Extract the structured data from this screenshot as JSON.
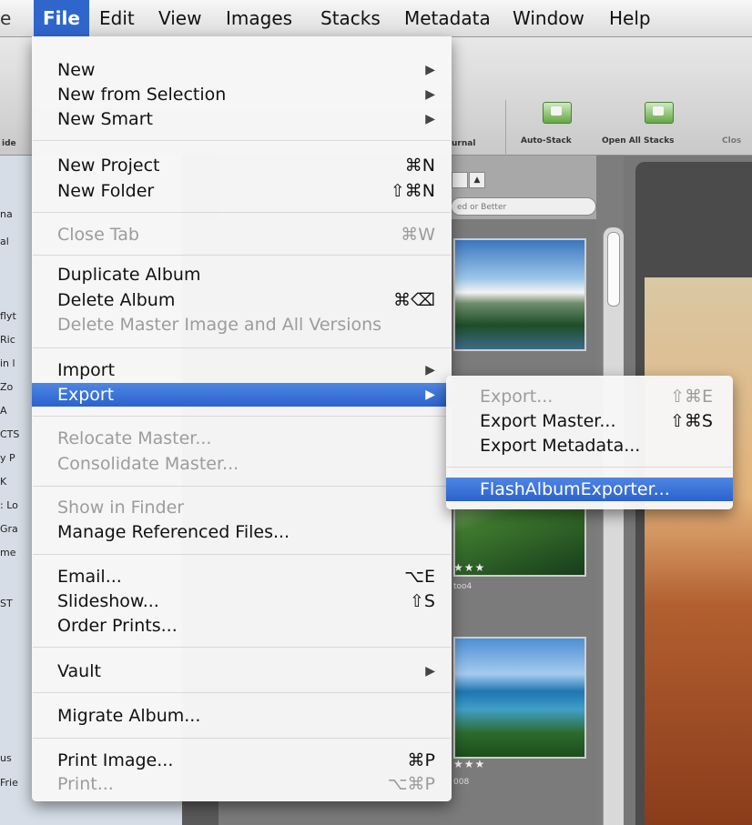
{
  "menubar": {
    "partial_left": "e",
    "items": [
      "File",
      "Edit",
      "View",
      "Images",
      "Stacks",
      "Metadata",
      "Window",
      "Help"
    ]
  },
  "file_menu": {
    "items": [
      {
        "label": "New",
        "shortcut": "",
        "submenu": true,
        "enabled": true
      },
      {
        "label": "New from Selection",
        "shortcut": "",
        "submenu": true,
        "enabled": true
      },
      {
        "label": "New Smart",
        "shortcut": "",
        "submenu": true,
        "enabled": true
      },
      {
        "label": "New Project",
        "shortcut": "⌘N",
        "submenu": false,
        "enabled": true
      },
      {
        "label": "New Folder",
        "shortcut": "⇧⌘N",
        "submenu": false,
        "enabled": true
      },
      {
        "label": "Close Tab",
        "shortcut": "⌘W",
        "submenu": false,
        "enabled": false
      },
      {
        "label": "Duplicate Album",
        "shortcut": "",
        "submenu": false,
        "enabled": true
      },
      {
        "label": "Delete Album",
        "shortcut": "⌘⌫",
        "submenu": false,
        "enabled": true
      },
      {
        "label": "Delete Master Image and All Versions",
        "shortcut": "",
        "submenu": false,
        "enabled": false
      },
      {
        "label": "Import",
        "shortcut": "",
        "submenu": true,
        "enabled": true
      },
      {
        "label": "Export",
        "shortcut": "",
        "submenu": true,
        "enabled": true,
        "highlighted": true
      },
      {
        "label": "Relocate Master...",
        "shortcut": "",
        "submenu": false,
        "enabled": false
      },
      {
        "label": "Consolidate Master...",
        "shortcut": "",
        "submenu": false,
        "enabled": false
      },
      {
        "label": "Show in Finder",
        "shortcut": "",
        "submenu": false,
        "enabled": false
      },
      {
        "label": "Manage Referenced Files...",
        "shortcut": "",
        "submenu": false,
        "enabled": true
      },
      {
        "label": "Email...",
        "shortcut": "⌥E",
        "submenu": false,
        "enabled": true
      },
      {
        "label": "Slideshow...",
        "shortcut": "⇧S",
        "submenu": false,
        "enabled": true
      },
      {
        "label": "Order Prints...",
        "shortcut": "",
        "submenu": false,
        "enabled": true
      },
      {
        "label": "Vault",
        "shortcut": "",
        "submenu": true,
        "enabled": true
      },
      {
        "label": "Migrate Album...",
        "shortcut": "",
        "submenu": false,
        "enabled": true
      },
      {
        "label": "Print Image...",
        "shortcut": "⌘P",
        "submenu": false,
        "enabled": true
      },
      {
        "label": "Print...",
        "shortcut": "⌥⌘P",
        "submenu": false,
        "enabled": false
      }
    ]
  },
  "export_submenu": {
    "items": [
      {
        "label": "Export...",
        "shortcut": "⇧⌘E",
        "enabled": false
      },
      {
        "label": "Export Master...",
        "shortcut": "⇧⌘S",
        "enabled": true
      },
      {
        "label": "Export Metadata...",
        "shortcut": "",
        "enabled": true
      },
      {
        "label": "FlashAlbumExporter...",
        "shortcut": "",
        "enabled": true,
        "highlighted": true
      }
    ]
  },
  "toolbar": {
    "journal_label": "urnal",
    "auto_stack_label": "Auto-Stack",
    "open_all_stacks_label": "Open All Stacks",
    "close_label": "Clos",
    "left_label": "ide"
  },
  "browser": {
    "filter_text": "ed or Better",
    "photo1_caption": "too4",
    "photo2_caption": "008",
    "stars": "★★★"
  },
  "sidebar_fragments": [
    "na",
    "al",
    "flyt",
    "Ric",
    "in l",
    "Zo",
    "A",
    "CTS",
    "y P",
    "K",
    ": Lo",
    "Gra",
    "me",
    "ST",
    "us",
    "Frie"
  ],
  "colors": {
    "highlight": "#2f66cc",
    "menu_bg": "#f6f6f6",
    "disabled_text": "#9c9c9c"
  }
}
